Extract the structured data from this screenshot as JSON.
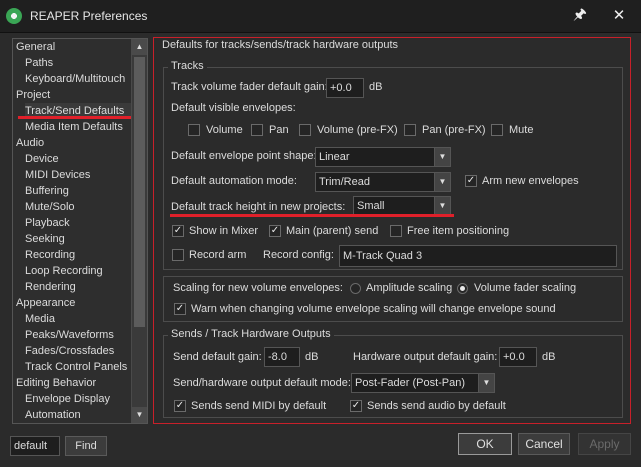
{
  "window": {
    "title": "REAPER Preferences",
    "pin_glyph": "🖈",
    "close_glyph": "✕"
  },
  "tree": {
    "items": [
      {
        "label": "General"
      },
      {
        "label": "Paths"
      },
      {
        "label": "Keyboard/Multitouch"
      },
      {
        "label": "Project"
      },
      {
        "label": "Track/Send Defaults"
      },
      {
        "label": "Media Item Defaults"
      },
      {
        "label": "Audio"
      },
      {
        "label": "Device"
      },
      {
        "label": "MIDI Devices"
      },
      {
        "label": "Buffering"
      },
      {
        "label": "Mute/Solo"
      },
      {
        "label": "Playback"
      },
      {
        "label": "Seeking"
      },
      {
        "label": "Recording"
      },
      {
        "label": "Loop Recording"
      },
      {
        "label": "Rendering"
      },
      {
        "label": "Appearance"
      },
      {
        "label": "Media"
      },
      {
        "label": "Peaks/Waveforms"
      },
      {
        "label": "Fades/Crossfades"
      },
      {
        "label": "Track Control Panels"
      },
      {
        "label": "Editing Behavior"
      },
      {
        "label": "Envelope Display"
      },
      {
        "label": "Automation"
      }
    ],
    "selected": "Track/Send Defaults",
    "scroll_up": "▲",
    "scroll_down": "▼"
  },
  "search": {
    "value": "default",
    "find_label": "Find"
  },
  "panel": {
    "title": "Defaults for tracks/sends/track hardware outputs",
    "tracks": {
      "group_title": "Tracks",
      "fader_gain_label": "Track volume fader default gain:",
      "fader_gain_value": "+0.0",
      "fader_gain_unit": "dB",
      "visible_env_label": "Default visible envelopes:",
      "env_volume": "Volume",
      "env_pan": "Pan",
      "env_volume_prefx": "Volume (pre-FX)",
      "env_pan_prefx": "Pan (pre-FX)",
      "env_mute": "Mute",
      "point_shape_label": "Default envelope point shape:",
      "point_shape_value": "Linear",
      "automation_mode_label": "Default automation mode:",
      "automation_mode_value": "Trim/Read",
      "arm_new_env": "Arm new envelopes",
      "track_height_label": "Default track height in new projects:",
      "track_height_value": "Small",
      "show_in_mixer": "Show in Mixer",
      "main_parent_send": "Main (parent) send",
      "free_item_pos": "Free item positioning",
      "record_arm": "Record arm",
      "record_config_label": "Record config:",
      "record_config_value": "M-Track Quad 3",
      "checkmark": "✓"
    },
    "scaling": {
      "label": "Scaling for new volume envelopes:",
      "amplitude": "Amplitude scaling",
      "fader": "Volume fader scaling",
      "warn": "Warn when changing volume envelope scaling will change envelope sound"
    },
    "sends": {
      "group_title": "Sends / Track Hardware Outputs",
      "send_gain_label": "Send default gain:",
      "send_gain_value": "-8.0",
      "send_gain_unit": "dB",
      "hw_gain_label": "Hardware output default gain:",
      "hw_gain_value": "+0.0",
      "hw_gain_unit": "dB",
      "mode_label": "Send/hardware output default mode:",
      "mode_value": "Post-Fader (Post-Pan)",
      "send_midi": "Sends send MIDI by default",
      "send_audio": "Sends send audio by default"
    }
  },
  "buttons": {
    "ok": "OK",
    "cancel": "Cancel",
    "apply": "Apply"
  },
  "colors": {
    "accent_red": "#e0202a",
    "background": "#2b2b2b"
  }
}
